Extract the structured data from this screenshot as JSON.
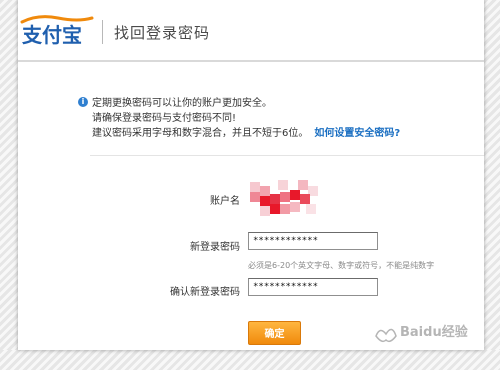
{
  "header": {
    "logo_text": "支付宝",
    "title": "找回登录密码"
  },
  "notice": {
    "icon": "info-icon",
    "line1": "定期更换密码可以让你的账户更加安全。",
    "line2": "请确保登录密码与支付密码不同!",
    "line3": "建议密码采用字母和数字混合，并且不短于6位。",
    "link": "如何设置安全密码?"
  },
  "form": {
    "account_label": "账户名",
    "account_value_note": "redacted-mosaic",
    "new_password_label": "新登录密码",
    "new_password_value": "************",
    "hint": "必须是6-20个英文字母、数字或符号，不能是纯数字",
    "confirm_password_label": "确认新登录密码",
    "confirm_password_value": "************",
    "submit_label": "确定"
  },
  "watermark": {
    "text": "Baidu经验"
  },
  "colors": {
    "logo_blue": "#1f5fae",
    "logo_orange": "#f08a0c",
    "link": "#1b6fc2",
    "button": "#f39a1a",
    "mosaic": "#e8182a"
  }
}
